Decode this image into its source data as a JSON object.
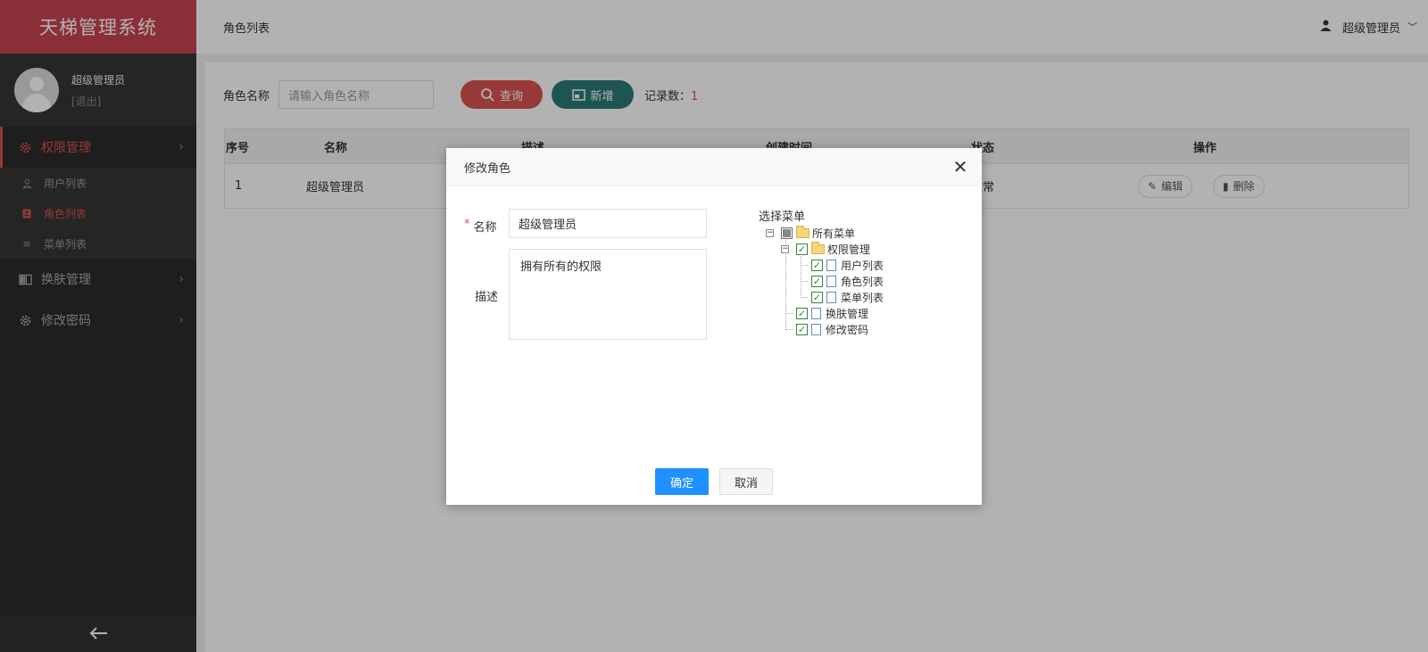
{
  "app": {
    "title": "天梯管理系统"
  },
  "user": {
    "name": "超级管理员",
    "logout": "[退出]"
  },
  "sidebar": {
    "groups": [
      {
        "label": "权限管理",
        "icon": "gear-icon",
        "active": true
      },
      {
        "label": "换肤管理",
        "icon": "book-icon"
      },
      {
        "label": "修改密码",
        "icon": "gear-icon"
      }
    ],
    "subitems": [
      {
        "label": "用户列表",
        "icon": "user-icon"
      },
      {
        "label": "角色列表",
        "icon": "id-card-icon",
        "active": true
      },
      {
        "label": "菜单列表",
        "icon": "list-icon"
      }
    ]
  },
  "topbar": {
    "breadcrumb": "角色列表",
    "username": "超级管理员"
  },
  "search": {
    "label": "角色名称",
    "placeholder": "请输入角色名称",
    "query_label": "查询",
    "add_label": "新增",
    "records_label": "记录数：",
    "records_count": "1"
  },
  "table": {
    "headers": [
      "序号",
      "名称",
      "描述",
      "创建时间",
      "状态",
      "操作"
    ],
    "rows": [
      {
        "index": "1",
        "name": "超级管理员",
        "status": "正常",
        "edit": "编辑",
        "delete": "删除"
      }
    ]
  },
  "modal": {
    "title": "修改角色",
    "name_label": "名称",
    "name_value": "超级管理员",
    "desc_label": "描述",
    "desc_value": "拥有所有的权限",
    "tree_title": "选择菜单",
    "tree": {
      "root": "所有菜单",
      "perm": "权限管理",
      "user_list": "用户列表",
      "role_list": "角色列表",
      "menu_list": "菜单列表",
      "skin": "换肤管理",
      "password": "修改密码"
    },
    "ok_label": "确定",
    "cancel_label": "取消"
  },
  "colors": {
    "brand": "#c9434f",
    "accent_red": "#d9534f",
    "teal": "#2b7a78",
    "primary": "#1e90ff"
  }
}
